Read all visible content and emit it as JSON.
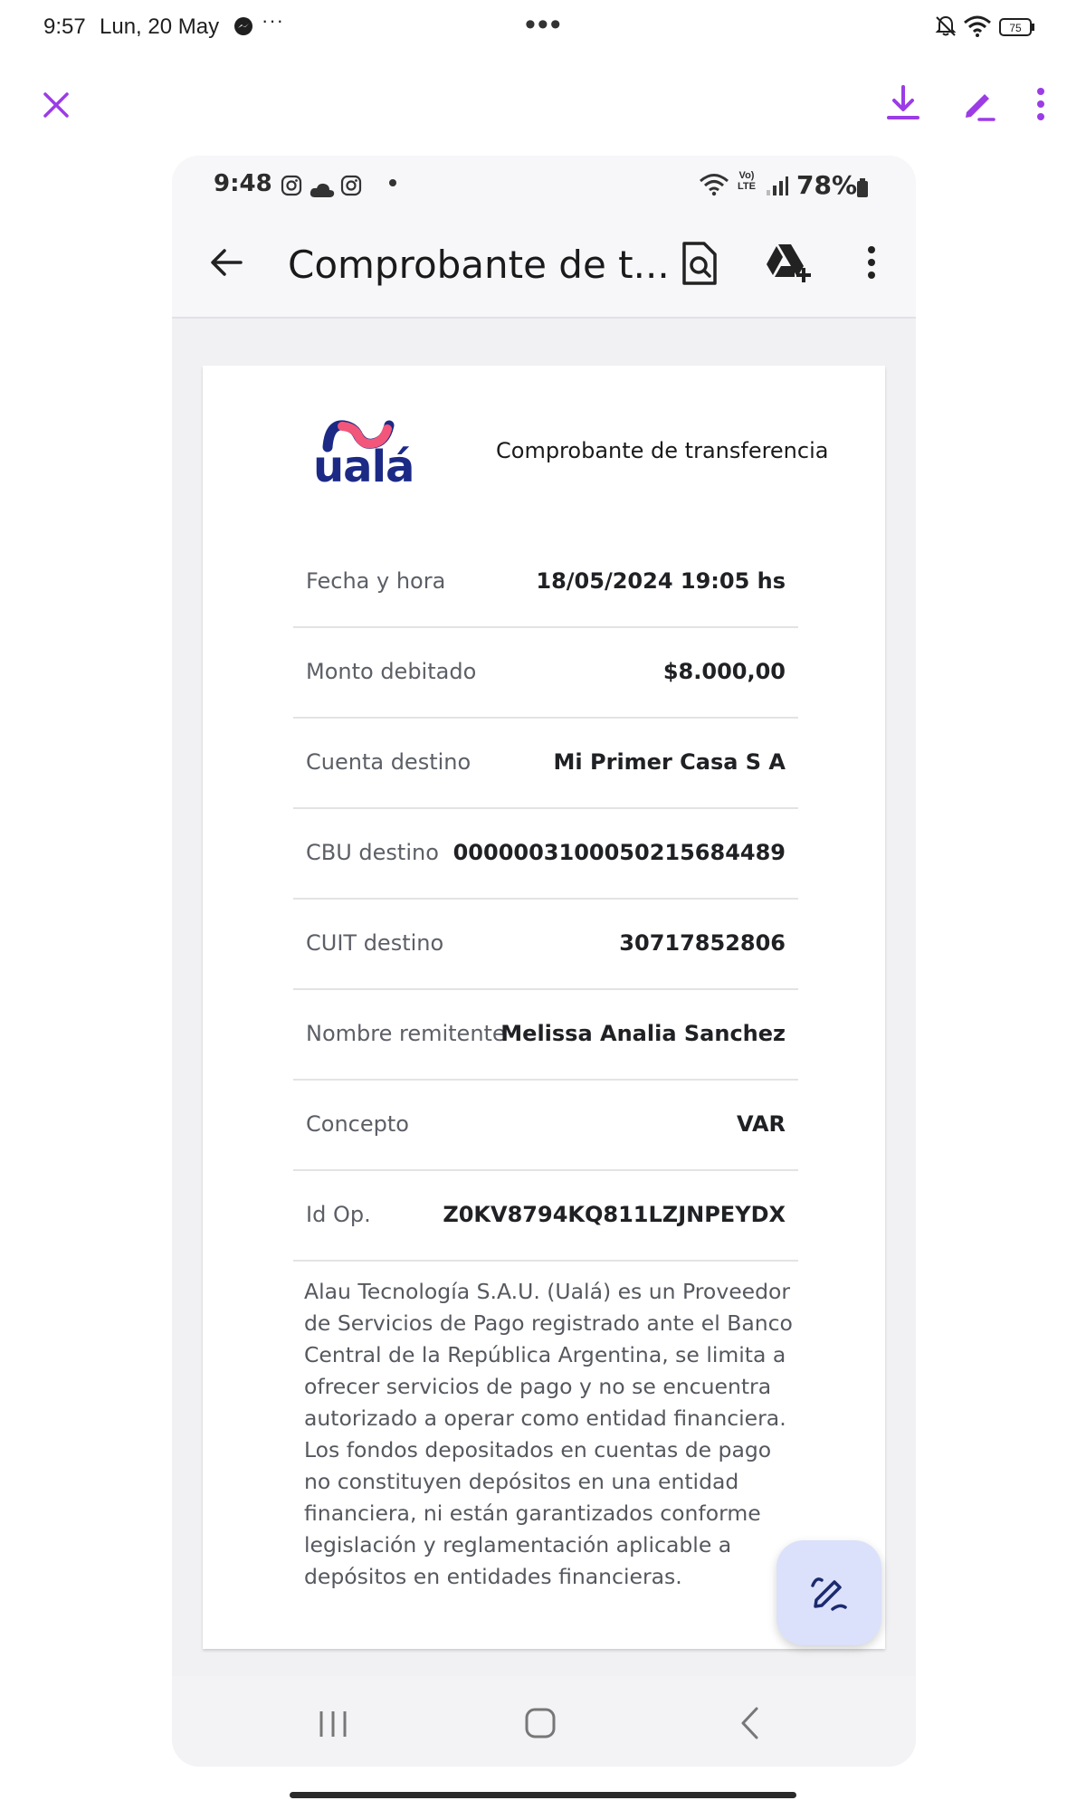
{
  "outer_status": {
    "time": "9:57",
    "date": "Lun, 20 May",
    "more": "···",
    "center": "•••",
    "battery": "75"
  },
  "outer_toolbar": {
    "icons": [
      "close-icon",
      "download-icon",
      "edit-pen-icon",
      "more-vertical-icon"
    ],
    "accent_color": "#9b3ce6"
  },
  "phone": {
    "status": {
      "time": "9:48",
      "lte": "Vo)\nLTE",
      "battery_text": "78%"
    },
    "appbar": {
      "title": "Comprobante de t..."
    },
    "receipt": {
      "brand": "ualá",
      "title": "Comprobante de transferencia",
      "rows": [
        {
          "label": "Fecha y hora",
          "value": "18/05/2024 19:05 hs"
        },
        {
          "label": "Monto debitado",
          "value": "$8.000,00"
        },
        {
          "label": "Cuenta destino",
          "value": "Mi Primer Casa S A"
        },
        {
          "label": "CBU destino",
          "value": "0000003100050215684489"
        },
        {
          "label": "CUIT destino",
          "value": "30717852806"
        },
        {
          "label": "Nombre remitente",
          "value": "Melissa Analia Sanchez"
        },
        {
          "label": "Concepto",
          "value": "VAR"
        },
        {
          "label": "Id Op.",
          "value": "Z0KV8794KQ811LZJNPEYDX"
        }
      ],
      "disclaimer": "Alau Tecnología S.A.U. (Ualá) es un Proveedor de Servicios de Pago registrado ante el Banco Central de la República Argentina, se limita a ofrecer servicios de pago y no se encuentra autorizado a operar como entidad financiera. Los fondos depositados en cuentas de pago no constituyen depósitos en una entidad financiera, ni están garantizados conforme legislación y reglamentación aplicable a depósitos en entidades financieras."
    },
    "brand_colors": {
      "primary": "#1c2a86",
      "accent": "#f2567a"
    }
  }
}
